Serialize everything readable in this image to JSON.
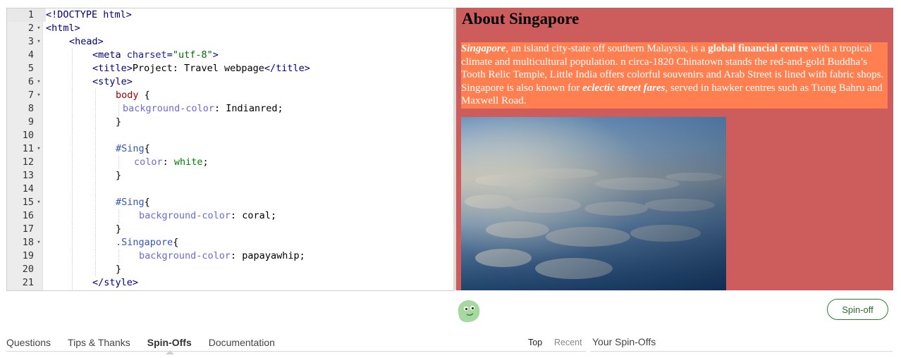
{
  "editor": {
    "lines": [
      {
        "n": "1",
        "fold": false,
        "indent": 0,
        "guides": 0,
        "tokens": [
          [
            "t-tag",
            "<!DOCTYPE html>"
          ]
        ]
      },
      {
        "n": "2",
        "fold": true,
        "indent": 0,
        "guides": 0,
        "tokens": [
          [
            "t-tag",
            "<html>"
          ]
        ]
      },
      {
        "n": "3",
        "fold": true,
        "indent": 1,
        "guides": 0,
        "tokens": [
          [
            "t-tag",
            "<head>"
          ]
        ]
      },
      {
        "n": "4",
        "fold": false,
        "indent": 2,
        "guides": 1,
        "tokens": [
          [
            "t-tag",
            "<meta "
          ],
          [
            "t-val",
            "charset"
          ],
          [
            "t-tag",
            "="
          ],
          [
            "t-str",
            "\"utf-8\""
          ],
          [
            "t-tag",
            ">"
          ]
        ]
      },
      {
        "n": "5",
        "fold": false,
        "indent": 2,
        "guides": 1,
        "tokens": [
          [
            "t-tag",
            "<title>"
          ],
          [
            "t-txt",
            "Project: Travel webpage"
          ],
          [
            "t-tag",
            "</title>"
          ]
        ]
      },
      {
        "n": "6",
        "fold": true,
        "indent": 2,
        "guides": 1,
        "tokens": [
          [
            "t-tag",
            "<style>"
          ]
        ]
      },
      {
        "n": "7",
        "fold": true,
        "indent": 3,
        "guides": 2,
        "tokens": [
          [
            "t-kw",
            "body "
          ],
          [
            "t-txt",
            "{"
          ]
        ]
      },
      {
        "n": "8",
        "fold": false,
        "indent": 3.3,
        "guides": 3,
        "tokens": [
          [
            "t-prop",
            "background-color"
          ],
          [
            "t-txt",
            ": Indianred;"
          ]
        ]
      },
      {
        "n": "9",
        "fold": false,
        "indent": 3,
        "guides": 2,
        "tokens": [
          [
            "t-txt",
            "}"
          ]
        ]
      },
      {
        "n": "10",
        "fold": false,
        "indent": 0,
        "guides": 2,
        "tokens": []
      },
      {
        "n": "11",
        "fold": true,
        "indent": 3,
        "guides": 2,
        "tokens": [
          [
            "t-id",
            "#Sing"
          ],
          [
            "t-txt",
            "{"
          ]
        ]
      },
      {
        "n": "12",
        "fold": false,
        "indent": 3.8,
        "guides": 3,
        "tokens": [
          [
            "t-prop",
            "color"
          ],
          [
            "t-txt",
            ": "
          ],
          [
            "t-lit",
            "white"
          ],
          [
            "t-txt",
            ";"
          ]
        ]
      },
      {
        "n": "13",
        "fold": false,
        "indent": 3,
        "guides": 2,
        "tokens": [
          [
            "t-txt",
            "}"
          ]
        ]
      },
      {
        "n": "14",
        "fold": false,
        "indent": 0,
        "guides": 2,
        "tokens": []
      },
      {
        "n": "15",
        "fold": true,
        "indent": 3,
        "guides": 2,
        "tokens": [
          [
            "t-id",
            "#Sing"
          ],
          [
            "t-txt",
            "{"
          ]
        ]
      },
      {
        "n": "16",
        "fold": false,
        "indent": 4,
        "guides": 3,
        "tokens": [
          [
            "t-prop",
            "background-color"
          ],
          [
            "t-txt",
            ": coral;"
          ]
        ]
      },
      {
        "n": "17",
        "fold": false,
        "indent": 3,
        "guides": 2,
        "tokens": [
          [
            "t-txt",
            "}"
          ]
        ]
      },
      {
        "n": "18",
        "fold": true,
        "indent": 3,
        "guides": 2,
        "tokens": [
          [
            "t-id",
            ".Singapore"
          ],
          [
            "t-txt",
            "{"
          ]
        ]
      },
      {
        "n": "19",
        "fold": false,
        "indent": 4,
        "guides": 3,
        "tokens": [
          [
            "t-prop",
            "background-color"
          ],
          [
            "t-txt",
            ": papayawhip;"
          ]
        ]
      },
      {
        "n": "20",
        "fold": false,
        "indent": 3,
        "guides": 2,
        "tokens": [
          [
            "t-txt",
            "}"
          ]
        ]
      },
      {
        "n": "21",
        "fold": false,
        "indent": 2,
        "guides": 1,
        "tokens": [
          [
            "t-tag",
            "</style>"
          ]
        ]
      }
    ]
  },
  "preview": {
    "heading": "About Singapore",
    "paragraph": {
      "em1": "Singapore",
      "t1": ", an island city-state off southern Malaysia, is a ",
      "b1": "global financial centre",
      "t2": " with a tropical climate and multicultural population. n circa-1820 Chinatown stands the red-and-gold Buddha’s Tooth Relic Temple, Little India offers colorful souvenirs and Arab Street is lined with fabric shops. Singapore is also known for ",
      "bi1": "eclectic street fares",
      "t3": ", served in hawker centres such as Tiong Bahru and Maxwell Road."
    }
  },
  "bottom": {
    "spin_off_label": "Spin-off",
    "tabs": [
      "Questions",
      "Tips & Thanks",
      "Spin-Offs",
      "Documentation"
    ],
    "active_tab": "Spin-Offs",
    "sort_top": "Top",
    "sort_recent": "Recent",
    "your_spinoffs": "Your Spin-Offs"
  }
}
